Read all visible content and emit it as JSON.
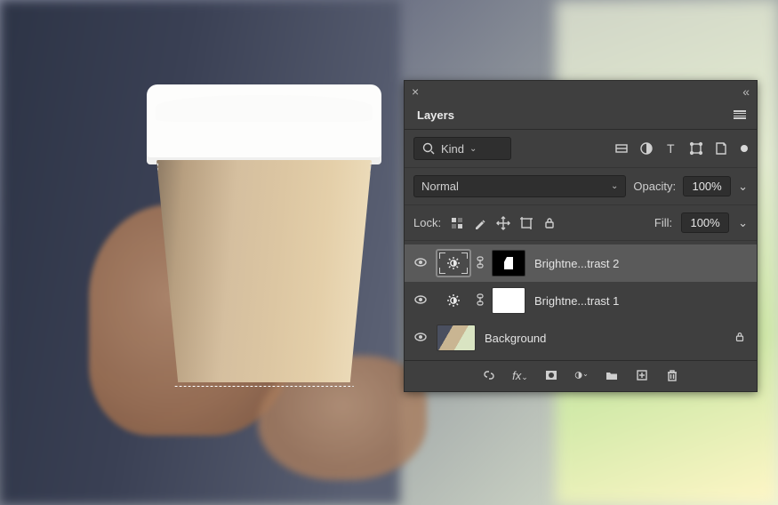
{
  "panel": {
    "title": "Layers",
    "filter": {
      "label": "Kind",
      "search_placeholder": "Kind"
    },
    "blend_mode": "Normal",
    "opacity_label": "Opacity:",
    "opacity_value": "100%",
    "lock_label": "Lock:",
    "fill_label": "Fill:",
    "fill_value": "100%",
    "layers": [
      {
        "name": "Brightne...trast 2",
        "type": "adjustment",
        "mask": "shape",
        "visible": true,
        "selected": true
      },
      {
        "name": "Brightne...trast 1",
        "type": "adjustment",
        "mask": "white",
        "visible": true,
        "selected": false
      },
      {
        "name": "Background",
        "type": "image",
        "locked": true,
        "visible": true,
        "selected": false
      }
    ],
    "icons": {
      "close": "×",
      "collapse": "«",
      "eye": "◉",
      "chevron": "⌄",
      "search": "search-icon",
      "link": "link-icon"
    }
  }
}
